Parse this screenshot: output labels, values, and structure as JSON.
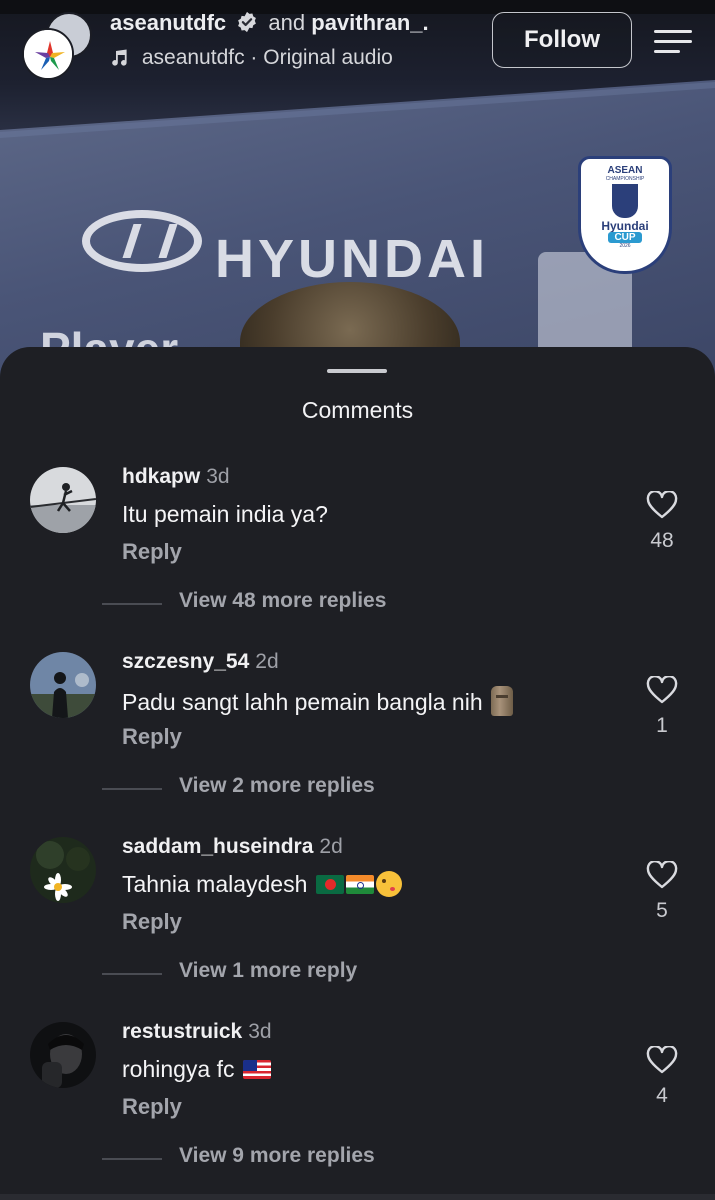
{
  "header": {
    "username": "aseanutdfc",
    "conjunction": "and",
    "collaborator": "pavithran_.",
    "audio_text": "aseanutdfc · Original audio",
    "follow_label": "Follow"
  },
  "video": {
    "sponsor_text": "HYUNDAI",
    "backdrop_text": "Player",
    "badge": {
      "top": "ASEAN",
      "sub": "CHAMPIONSHIP",
      "brand": "Hyundai",
      "cup": "CUP",
      "year": "2026"
    }
  },
  "comments_sheet": {
    "title": "Comments",
    "reply_label": "Reply",
    "comments": [
      {
        "username": "hdkapw",
        "time": "3d",
        "text": "Itu pemain india ya?",
        "likes": "48",
        "view_replies": "View 48 more replies",
        "emojis": []
      },
      {
        "username": "szczesny_54",
        "time": "2d",
        "text": "Padu sangt lahh pemain bangla nih",
        "likes": "1",
        "view_replies": "View 2 more replies",
        "emojis": [
          "moai"
        ]
      },
      {
        "username": "saddam_huseindra",
        "time": "2d",
        "text": "Tahnia malaydesh",
        "likes": "5",
        "view_replies": "View 1 more reply",
        "emojis": [
          "flag-bangladesh",
          "flag-india",
          "face-blowing-kiss"
        ]
      },
      {
        "username": "restustruick",
        "time": "3d",
        "text": "rohingya fc",
        "likes": "4",
        "view_replies": "View 9 more replies",
        "emojis": [
          "flag-malaysia"
        ]
      }
    ]
  },
  "colors": {
    "sheet_bg": "#1e1f24",
    "text_primary": "#f4f4f6",
    "text_secondary": "#a3a5ac"
  }
}
